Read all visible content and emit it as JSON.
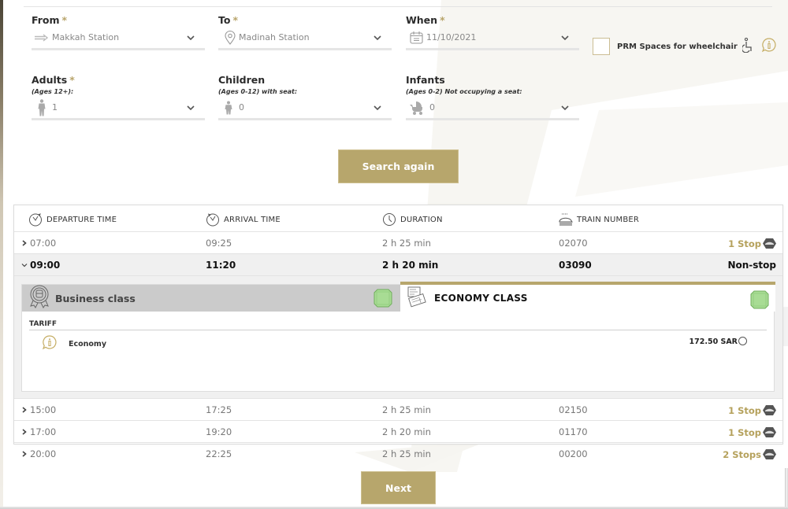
{
  "search_form": {
    "from": {
      "label": "From",
      "required_mark": "*",
      "value": "Makkah Station",
      "icon": "arrow-right-icon"
    },
    "to": {
      "label": "To",
      "required_mark": "*",
      "value": "Madinah Station",
      "icon": "location-pin-icon"
    },
    "when": {
      "label": "When",
      "required_mark": "*",
      "value": "11/10/2021",
      "icon": "calendar-icon"
    },
    "prm": {
      "label": "PRM Spaces for wheelchair",
      "checked": false,
      "icons": [
        "wheelchair-icon",
        "info-icon"
      ]
    },
    "adults": {
      "label": "Adults",
      "required_mark": "*",
      "sublabel": "(Ages 12+):",
      "value": "1",
      "icon": "adult-icon"
    },
    "children": {
      "label": "Children",
      "sublabel": "(Ages 0-12) with seat:",
      "value": "0",
      "icon": "child-icon"
    },
    "infants": {
      "label": "Infants",
      "sublabel": "(Ages 0-2) Not occupying a seat:",
      "value": "0",
      "icon": "stroller-icon"
    },
    "search_button": "Search again"
  },
  "results": {
    "columns": [
      {
        "label": "DEPARTURE TIME",
        "icon": "departure-clock-icon"
      },
      {
        "label": "ARRIVAL TIME",
        "icon": "arrival-clock-icon"
      },
      {
        "label": "DURATION",
        "icon": "clock-icon"
      },
      {
        "label": "TRAIN NUMBER",
        "icon": "train-icon"
      }
    ],
    "rows": [
      {
        "departure": "07:00",
        "arrival": "09:25",
        "duration": "2 h 25 min",
        "train": "02070",
        "stops": "1 Stop",
        "expanded": false
      },
      {
        "departure": "09:00",
        "arrival": "11:20",
        "duration": "2 h 20 min",
        "train": "03090",
        "stops": "Non-stop",
        "expanded": true
      },
      {
        "departure": "15:00",
        "arrival": "17:25",
        "duration": "2 h 25 min",
        "train": "02150",
        "stops": "1 Stop",
        "expanded": false
      },
      {
        "departure": "17:00",
        "arrival": "19:20",
        "duration": "2 h 20 min",
        "train": "01170",
        "stops": "1 Stop",
        "expanded": false
      },
      {
        "departure": "20:00",
        "arrival": "22:25",
        "duration": "2 h 25 min",
        "train": "00200",
        "stops": "2 Stops",
        "expanded": false
      }
    ],
    "detail": {
      "business_tab": "Business class",
      "economy_tab": "ECONOMY CLASS",
      "active_tab": "ECONOMY CLASS",
      "tariff_header": "TARIFF",
      "tariffs": [
        {
          "name": "Economy",
          "price": "172.50 SAR",
          "selected": false
        }
      ]
    }
  },
  "next_button": "Next",
  "colors": {
    "accent": "#b7a66c",
    "seat_available": "#a8dc94",
    "tab_inactive": "#cbcbcb"
  }
}
